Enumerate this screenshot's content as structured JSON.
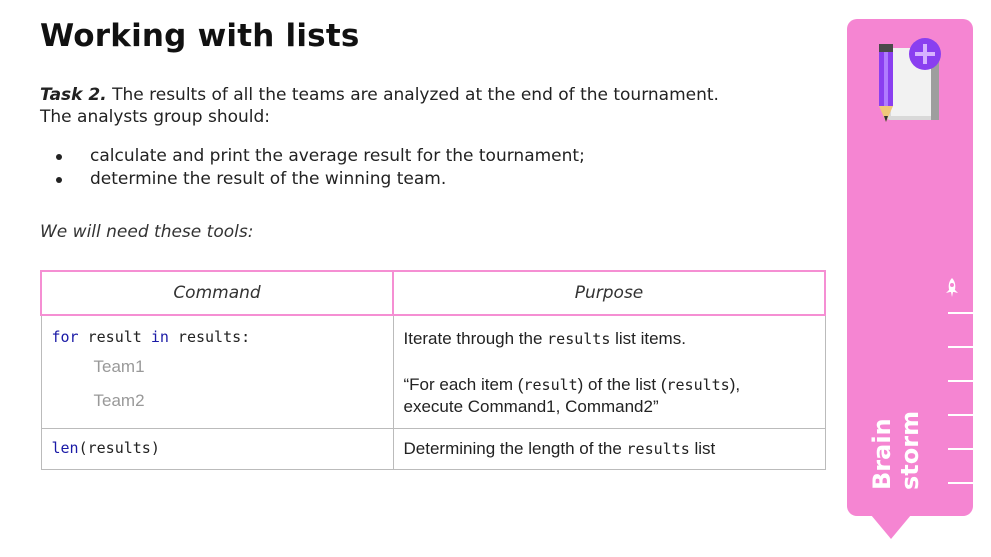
{
  "title": "Working with lists",
  "task": {
    "label": "Task 2.",
    "text": " The results of all the teams are analyzed at the end of the tournament. The analysts group should:"
  },
  "bullets": [
    "calculate and print the average result for the tournament;",
    "determine the result of the winning team."
  ],
  "tools_intro": "We will need these tools:",
  "table": {
    "headers": [
      "Command",
      "Purpose"
    ],
    "row1": {
      "kw_for": "for",
      "var": " result ",
      "kw_in": "in",
      "iter": " results:",
      "team1": "Team1",
      "team2": "Team2",
      "purpose_a1": "Iterate through the ",
      "purpose_a_code": "results",
      "purpose_a2": " list items.",
      "purpose_b1": "“For each item (",
      "purpose_b_code1": "result",
      "purpose_b2": ") of the list (",
      "purpose_b_code2": "results",
      "purpose_b3": "),",
      "purpose_b4": "execute Command1, Command2”"
    },
    "row2": {
      "kw_len": "len",
      "args": "(results)",
      "purpose1": "Determining the length of the ",
      "purpose_code": "results",
      "purpose2": " list"
    }
  },
  "sidebar": {
    "brain_label": "Brain",
    "storm_label": "storm",
    "icon": "notebook-pencil-plus-icon",
    "progress_icon": "rocket-icon",
    "accent_color": "#f585d2"
  }
}
